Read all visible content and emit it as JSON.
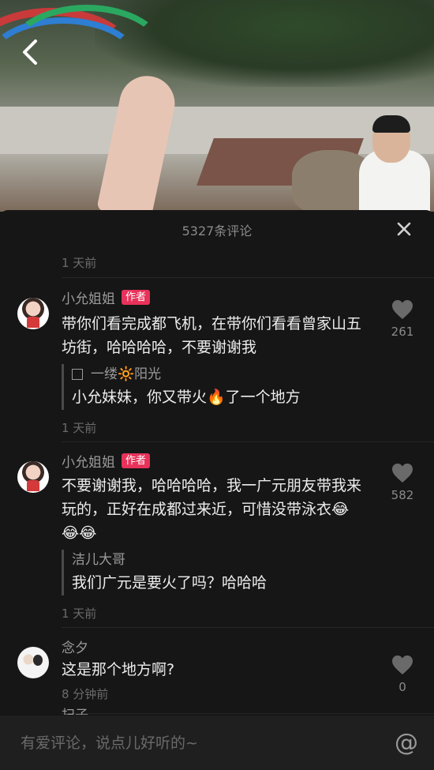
{
  "header": {
    "title": "5327条评论"
  },
  "icons": {
    "back": "chevron-left-icon",
    "close": "close-icon",
    "like": "heart-icon",
    "at": "at-icon"
  },
  "colors": {
    "accent": "#e8325a",
    "sheet_bg": "#161616"
  },
  "comments": [
    {
      "time_above": "1 天前",
      "name": "小允姐姐",
      "badge": "作者",
      "text": "带你们看完成都飞机，在带你们看看曾家山五坊街，哈哈哈哈，不要谢谢我",
      "likes": "261",
      "reply": {
        "name": "一缕🔆阳光",
        "text": "小允妹妹，你又带火🔥了一个地方"
      },
      "time_below": "1 天前"
    },
    {
      "name": "小允姐姐",
      "badge": "作者",
      "text": "不要谢谢我，哈哈哈哈，我一广元朋友带我来玩的，正好在成都过来近，可惜没带泳衣😂😂😂",
      "likes": "582",
      "reply": {
        "name": "洁儿大哥",
        "text": "我们广元是要火了吗？哈哈哈"
      },
      "time_below": "1 天前"
    },
    {
      "name": "念夕",
      "text": "这是那个地方啊?",
      "likes": "0",
      "time_below": "8 分钟前"
    }
  ],
  "input": {
    "placeholder": "有爱评论，说点儿好听的~",
    "at_symbol": "@"
  },
  "next_name_peek": "扫子"
}
